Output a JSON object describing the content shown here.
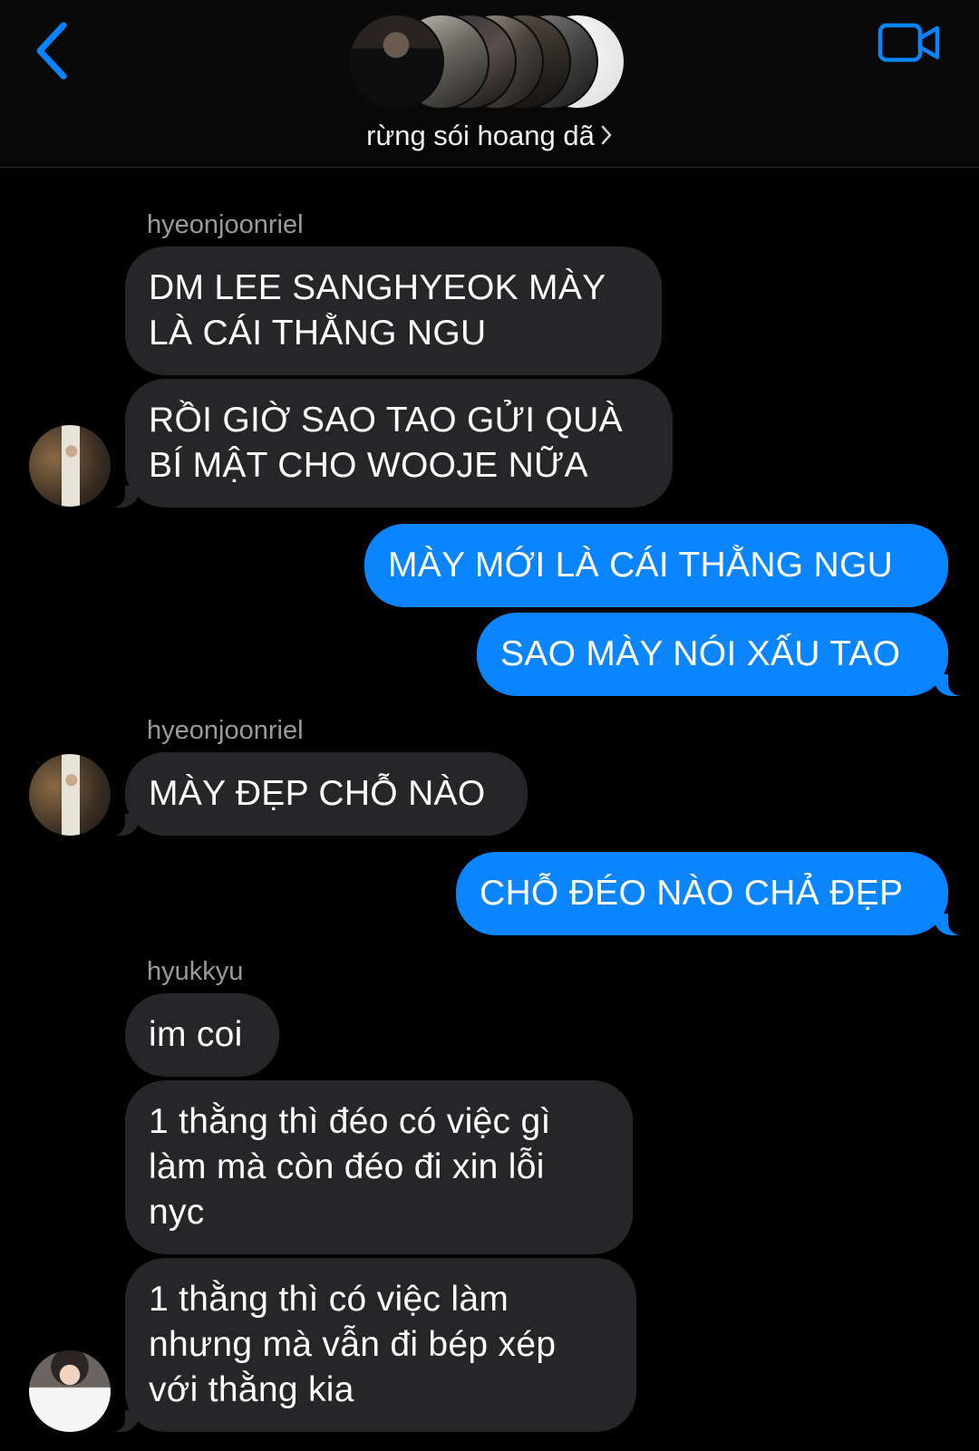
{
  "header": {
    "group_name": "rừng sói hoang dã",
    "back_icon": "chevron-left-icon",
    "video_icon": "video-camera-icon",
    "accent_color": "#0a84ff",
    "member_avatar_count": 7
  },
  "messages": [
    {
      "sender": "hyeonjoonriel",
      "lines": [
        "DM LEE SANGHYEOK MÀY",
        "LÀ CÁI THẰNG NGU"
      ]
    },
    {
      "lines": [
        "RỒI GIỜ SAO TAO GỬI QUÀ",
        "BÍ MẬT CHO WOOJE NỮA"
      ]
    },
    {
      "lines": [
        "MÀY MỚI LÀ CÁI THẰNG NGU"
      ]
    },
    {
      "lines": [
        "SAO MÀY NÓI XẤU TAO"
      ]
    },
    {
      "sender": "hyeonjoonriel",
      "lines": [
        "MÀY ĐẸP CHỖ NÀO"
      ]
    },
    {
      "lines": [
        "CHỖ ĐÉO NÀO CHẢ ĐẸP"
      ]
    },
    {
      "sender": "hyukkyu",
      "lines": [
        "im coi"
      ]
    },
    {
      "lines": [
        "1 thằng thì đéo có việc gì",
        "làm mà còn đéo đi xin lỗi",
        "nyc"
      ]
    },
    {
      "lines": [
        "1 thằng thì có việc làm",
        "nhưng mà vẫn đi bép xép",
        "với thằng kia"
      ]
    }
  ],
  "colors": {
    "incoming_bubble": "#262628",
    "outgoing_bubble": "#0a84ff",
    "background": "#000000",
    "sender_name": "#9a9a9a"
  }
}
